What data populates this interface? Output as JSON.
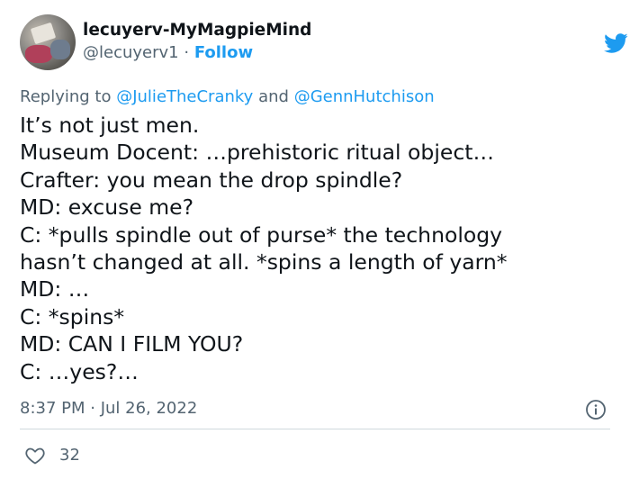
{
  "author": {
    "display_name": "lecuyerv-MyMagpieMind",
    "handle": "@lecuyerv1",
    "separator": "·",
    "follow_label": "Follow"
  },
  "reply_context": {
    "prefix": "Replying to",
    "mention1": "@JulieTheCranky",
    "conjunction": "and",
    "mention2": "@GennHutchison"
  },
  "body_lines": [
    "It’s not just men.",
    "Museum Docent: …prehistoric ritual object…",
    "Crafter: you mean the drop spindle?",
    "MD: excuse me?",
    "C: *pulls spindle out of purse* the technology",
    "hasn’t changed at all. *spins a length of yarn*",
    "MD: …",
    "C: *spins*",
    "MD: CAN I FILM YOU?",
    "C: …yes?…"
  ],
  "timestamp": "8:37 PM · Jul 26, 2022",
  "like_count": "32",
  "icons": {
    "brand": "twitter-bird-icon",
    "info": "info-icon",
    "like": "heart-icon"
  },
  "colors": {
    "accent": "#1d9bf0",
    "text": "#0f1419",
    "muted": "#536471",
    "divider": "#cfd9de"
  }
}
